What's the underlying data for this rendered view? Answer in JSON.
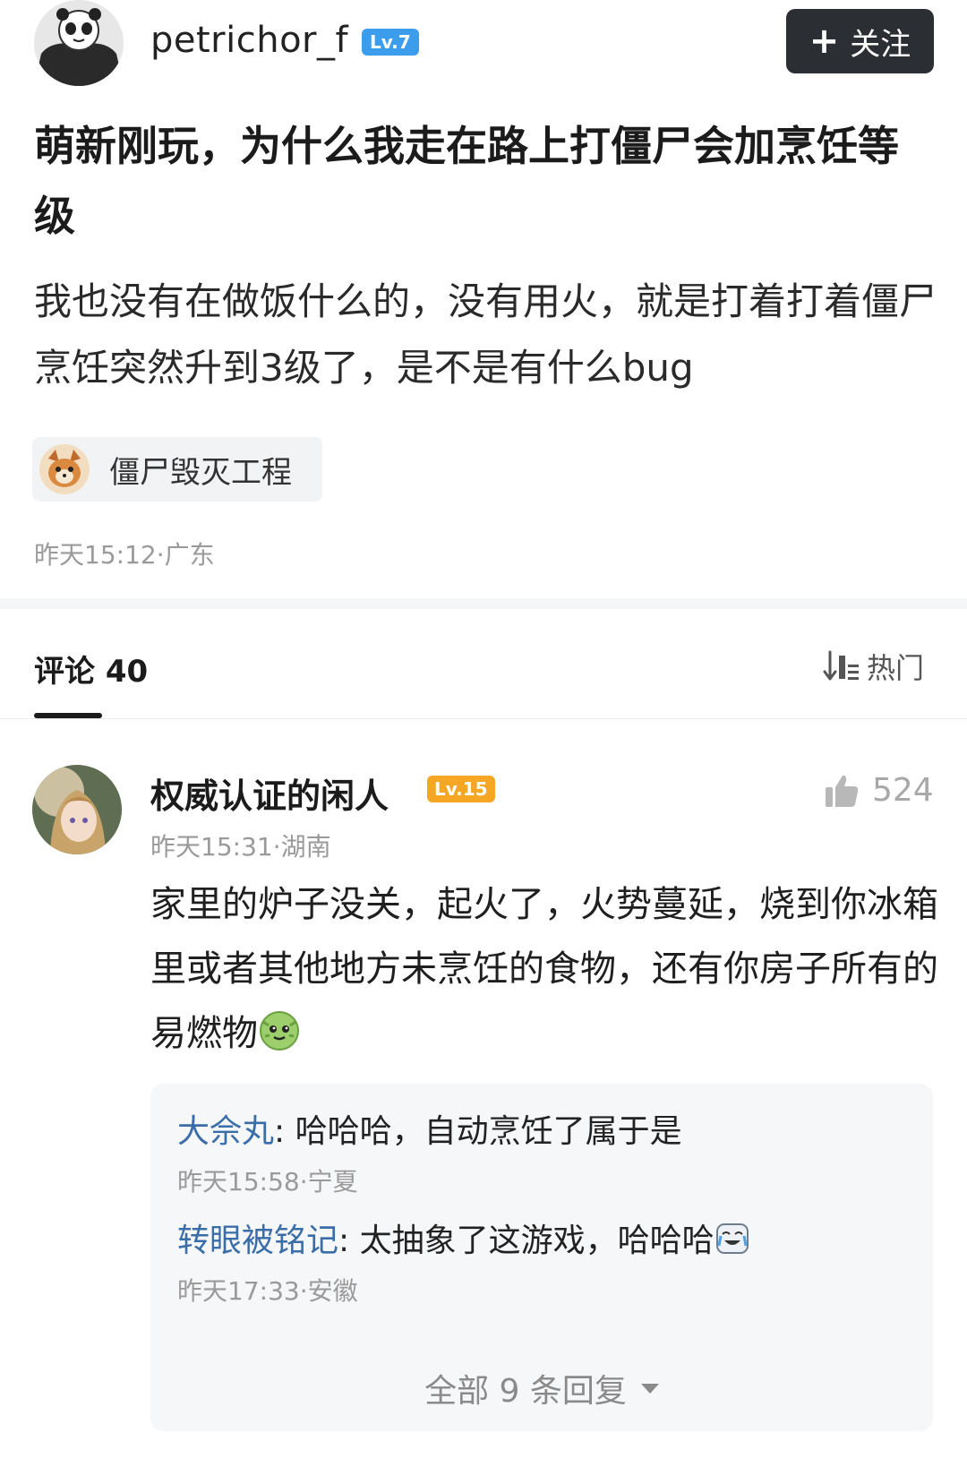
{
  "header": {
    "username": "petrichor_f",
    "level": "Lv.7",
    "follow_label": "关注"
  },
  "post": {
    "title": "萌新刚玩，为什么我走在路上打僵尸会加烹饪等级",
    "body": "我也没有在做饭什么的，没有用火，就是打着打着僵尸烹饪突然升到3级了，是不是有什么bug",
    "topic": "僵尸毁灭工程",
    "meta": "昨天15:12·广东"
  },
  "comments_section": {
    "label": "评论 40",
    "sort_label": "热门"
  },
  "comment": {
    "author": "权威认证的闲人",
    "level": "Lv.15",
    "likes": "524",
    "meta": "昨天15:31·湖南",
    "body": "家里的炉子没关，起火了，火势蔓延，烧到你冰箱里或者其他地方未烹饪的食物，还有你房子所有的易燃物",
    "emoji": "green-monster-emoji"
  },
  "replies": [
    {
      "author": "大佘丸",
      "text": "哈哈哈，自动烹饪了属于是",
      "meta": "昨天15:58·宁夏"
    },
    {
      "author": "转眼被铭记",
      "text": "太抽象了这游戏，哈哈哈",
      "meta": "昨天17:33·安徽",
      "emoji": "laugh-cry-emoji"
    }
  ],
  "view_all_label": "全部 9 条回复",
  "colors": {
    "follow_bg": "#2b2f33",
    "lv_blue": "#3d9ded",
    "lv_orange": "#f5a623",
    "reply_author": "#3a6ea8",
    "meta_gray": "#9a9a9a"
  }
}
